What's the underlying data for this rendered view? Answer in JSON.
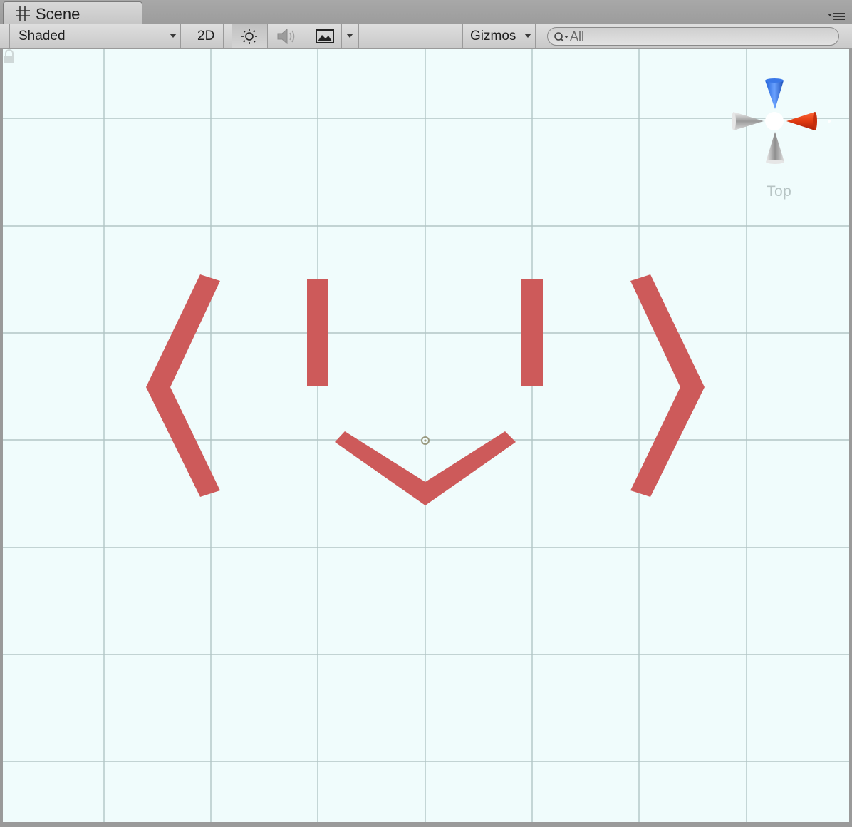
{
  "window": {
    "tab_label": "Scene",
    "tab_icon": "scene-grid-icon"
  },
  "toolbar": {
    "draw_mode": "Shaded",
    "mode_2d": "2D",
    "lighting_icon": "sun-icon",
    "audio_icon": "speaker-icon",
    "effects_icon": "image-icon",
    "gizmos_label": "Gizmos",
    "search_placeholder": "All"
  },
  "scene": {
    "background_color": "#f0fcfc",
    "grid_color": "#b2c5c5",
    "shape_color": "#cd5a5a",
    "view_label": "Top",
    "gizmo_axes": {
      "y": "#3a78e8",
      "x": "#e84418",
      "neutral": "#d8d8d8"
    }
  }
}
